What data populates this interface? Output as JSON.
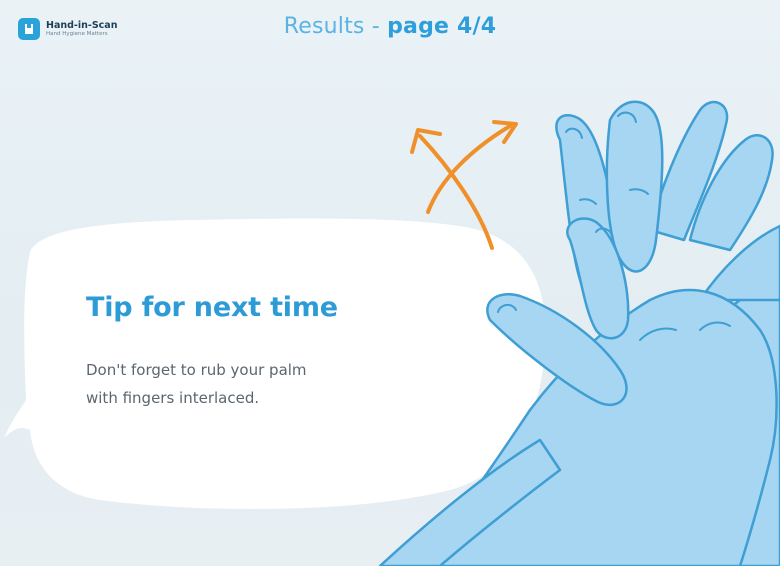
{
  "header": {
    "logo_name": "Hand-in-Scan",
    "logo_tagline": "Hand Hygiene Matters",
    "title_prefix": "Results - ",
    "title_page": "page 4/4"
  },
  "tip": {
    "heading": "Tip for next time",
    "line1": "Don't forget to rub your palm",
    "line2": "with fingers interlaced."
  },
  "icons": [
    "hand-in-scan-logo-icon",
    "crossed-arrows-icon",
    "interlaced-hands-illustration"
  ],
  "colors": {
    "accent": "#2c9bd6",
    "arrow": "#f0902a",
    "hand_fill": "#a6d6f1",
    "hand_outline": "#3f9ed4",
    "background": "#e6eef3"
  }
}
